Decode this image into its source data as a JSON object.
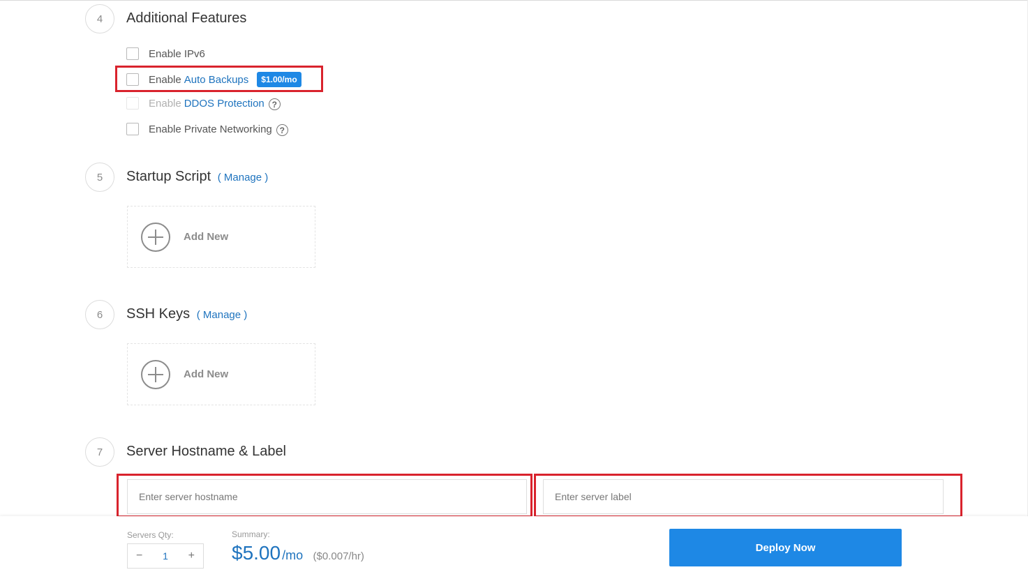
{
  "colors": {
    "accent": "#1e88e5",
    "link": "#1e73be",
    "highlight": "#d9232d"
  },
  "section4": {
    "number": "4",
    "title": "Additional Features",
    "features": [
      {
        "prefix": "Enable IPv6",
        "link": "",
        "badge": "",
        "help": false,
        "disabled": false
      },
      {
        "prefix": "Enable",
        "link": "Auto Backups",
        "badge": "$1.00/mo",
        "help": false,
        "disabled": false
      },
      {
        "prefix": "Enable",
        "link": "DDOS Protection",
        "badge": "",
        "help": true,
        "disabled": true
      },
      {
        "prefix": "Enable Private Networking",
        "link": "",
        "badge": "",
        "help": true,
        "disabled": false
      }
    ],
    "help_glyph": "?"
  },
  "section5": {
    "number": "5",
    "title": "Startup Script",
    "manage": "( Manage )",
    "manage_link": "Manage",
    "add_label": "Add New"
  },
  "section6": {
    "number": "6",
    "title": "SSH Keys",
    "manage": "( Manage )",
    "manage_link": "Manage",
    "add_label": "Add New"
  },
  "section7": {
    "number": "7",
    "title": "Server Hostname & Label",
    "hostname_placeholder": "Enter server hostname",
    "hostname_value": "",
    "label_placeholder": "Enter server label",
    "label_value": ""
  },
  "footer": {
    "qty_label": "Servers Qty:",
    "qty_minus": "−",
    "qty_value": "1",
    "qty_plus": "+",
    "summary_label": "Summary:",
    "price": "$5.00",
    "price_unit": "/mo",
    "price_hourly": "($0.007/hr)",
    "deploy_label": "Deploy Now"
  }
}
